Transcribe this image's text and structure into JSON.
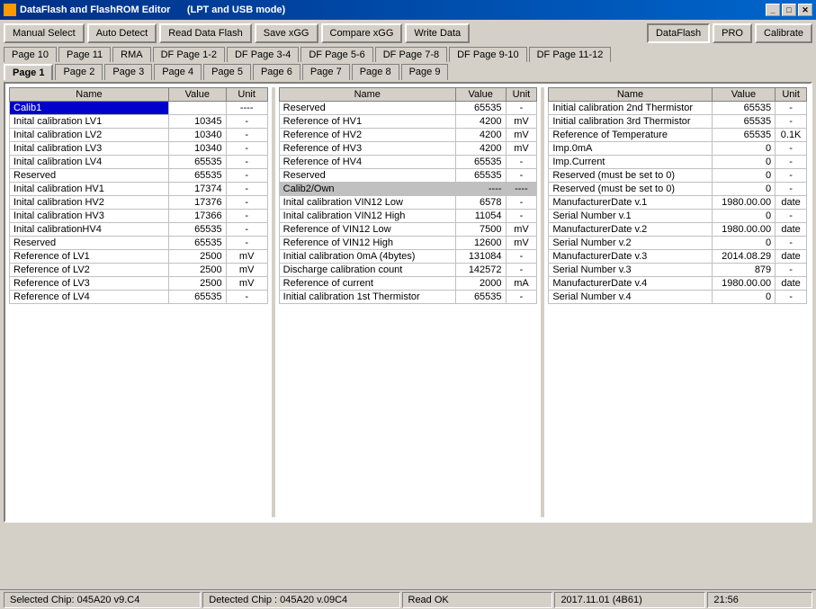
{
  "titleBar": {
    "title": "DataFlash  and  FlashROM  Editor",
    "subtitle": "(LPT and USB mode)",
    "minimizeBtn": "_",
    "maximizeBtn": "□",
    "closeBtn": "✕"
  },
  "toolbar": {
    "buttons": [
      {
        "id": "manual-select",
        "label": "Manual Select"
      },
      {
        "id": "auto-detect",
        "label": "Auto Detect"
      },
      {
        "id": "read-data-flash",
        "label": "Read Data Flash"
      },
      {
        "id": "save-xgg",
        "label": "Save xGG"
      },
      {
        "id": "compare-xgg",
        "label": "Compare xGG"
      },
      {
        "id": "write-data",
        "label": "Write Data"
      },
      {
        "id": "dataflash",
        "label": "DataFlash",
        "active": true
      },
      {
        "id": "pro",
        "label": "PRO"
      },
      {
        "id": "calibrate",
        "label": "Calibrate"
      }
    ]
  },
  "topTabs": [
    {
      "id": "page10",
      "label": "Page 10"
    },
    {
      "id": "page11",
      "label": "Page 11"
    },
    {
      "id": "rma",
      "label": "RMA"
    },
    {
      "id": "df-page-1-2",
      "label": "DF Page 1-2"
    },
    {
      "id": "df-page-3-4",
      "label": "DF Page 3-4"
    },
    {
      "id": "df-page-5-6",
      "label": "DF Page 5-6"
    },
    {
      "id": "df-page-7-8",
      "label": "DF Page 7-8"
    },
    {
      "id": "df-page-9-10",
      "label": "DF Page 9-10"
    },
    {
      "id": "df-page-11-12",
      "label": "DF Page 11-12"
    }
  ],
  "bottomTabs": [
    {
      "id": "page1",
      "label": "Page 1",
      "active": true
    },
    {
      "id": "page2",
      "label": "Page 2"
    },
    {
      "id": "page3",
      "label": "Page 3"
    },
    {
      "id": "page4",
      "label": "Page 4"
    },
    {
      "id": "page5",
      "label": "Page 5"
    },
    {
      "id": "page6",
      "label": "Page 6"
    },
    {
      "id": "page7",
      "label": "Page 7"
    },
    {
      "id": "page8",
      "label": "Page 8"
    },
    {
      "id": "page9",
      "label": "Page 9"
    }
  ],
  "table1": {
    "headers": [
      "Name",
      "Value",
      "Unit"
    ],
    "rows": [
      {
        "name": "Calib1",
        "value": "",
        "unit": "----",
        "highlight": "blue"
      },
      {
        "name": "Inital calibration LV1",
        "value": "10345",
        "unit": "-"
      },
      {
        "name": "Inital calibration LV2",
        "value": "10340",
        "unit": "-"
      },
      {
        "name": "Inital calibration LV3",
        "value": "10340",
        "unit": "-"
      },
      {
        "name": "Inital calibration LV4",
        "value": "65535",
        "unit": "-"
      },
      {
        "name": "Reserved",
        "value": "65535",
        "unit": "-"
      },
      {
        "name": "Inital calibration HV1",
        "value": "17374",
        "unit": "-"
      },
      {
        "name": "Inital calibration HV2",
        "value": "17376",
        "unit": "-"
      },
      {
        "name": "Inital calibration HV3",
        "value": "17366",
        "unit": "-"
      },
      {
        "name": "Inital calibrationHV4",
        "value": "65535",
        "unit": "-"
      },
      {
        "name": "Reserved",
        "value": "65535",
        "unit": "-"
      },
      {
        "name": "Reference of LV1",
        "value": "2500",
        "unit": "mV"
      },
      {
        "name": "Reference of LV2",
        "value": "2500",
        "unit": "mV"
      },
      {
        "name": "Reference of LV3",
        "value": "2500",
        "unit": "mV"
      },
      {
        "name": "Reference of LV4",
        "value": "65535",
        "unit": "-"
      }
    ]
  },
  "table2": {
    "headers": [
      "Name",
      "Value",
      "Unit"
    ],
    "rows": [
      {
        "name": "Reserved",
        "value": "65535",
        "unit": "-"
      },
      {
        "name": "Reference of HV1",
        "value": "4200",
        "unit": "mV"
      },
      {
        "name": "Reference of HV2",
        "value": "4200",
        "unit": "mV"
      },
      {
        "name": "Reference of HV3",
        "value": "4200",
        "unit": "mV"
      },
      {
        "name": "Reference of HV4",
        "value": "65535",
        "unit": "-"
      },
      {
        "name": "Reserved",
        "value": "65535",
        "unit": "-"
      },
      {
        "name": "Calib2/Own",
        "value": "----",
        "unit": "----",
        "highlight": "gray"
      },
      {
        "name": "Inital calibration VIN12 Low",
        "value": "6578",
        "unit": "-"
      },
      {
        "name": "Inital calibration VIN12 High",
        "value": "11054",
        "unit": "-"
      },
      {
        "name": "Reference of VIN12 Low",
        "value": "7500",
        "unit": "mV"
      },
      {
        "name": "Reference of VIN12 High",
        "value": "12600",
        "unit": "mV"
      },
      {
        "name": "Initial calibration 0mA (4bytes)",
        "value": "131084",
        "unit": "-"
      },
      {
        "name": "Discharge calibration count",
        "value": "142572",
        "unit": "-"
      },
      {
        "name": "Reference of current",
        "value": "2000",
        "unit": "mA"
      },
      {
        "name": "Initial calibration 1st Thermistor",
        "value": "65535",
        "unit": "-"
      }
    ]
  },
  "table3": {
    "headers": [
      "Name",
      "Value",
      "Unit"
    ],
    "rows": [
      {
        "name": "Initial calibration 2nd Thermistor",
        "value": "65535",
        "unit": "-"
      },
      {
        "name": "Initial calibration 3rd Thermistor",
        "value": "65535",
        "unit": "-"
      },
      {
        "name": "Reference of Temperature",
        "value": "65535",
        "unit": "0.1K"
      },
      {
        "name": "Imp.0mA",
        "value": "0",
        "unit": "-"
      },
      {
        "name": "Imp.Current",
        "value": "0",
        "unit": "-"
      },
      {
        "name": "Reserved (must be set to 0)",
        "value": "0",
        "unit": "-"
      },
      {
        "name": "Reserved (must be set to 0)",
        "value": "0",
        "unit": "-"
      },
      {
        "name": "ManufacturerDate v.1",
        "value": "1980.00.00",
        "unit": "date"
      },
      {
        "name": "Serial Number v.1",
        "value": "0",
        "unit": "-"
      },
      {
        "name": "ManufacturerDate v.2",
        "value": "1980.00.00",
        "unit": "date"
      },
      {
        "name": "Serial Number v.2",
        "value": "0",
        "unit": "-"
      },
      {
        "name": "ManufacturerDate v.3",
        "value": "2014.08.29",
        "unit": "date"
      },
      {
        "name": "Serial Number v.3",
        "value": "879",
        "unit": "-"
      },
      {
        "name": "ManufacturerDate v.4",
        "value": "1980.00.00",
        "unit": "date"
      },
      {
        "name": "Serial Number v.4",
        "value": "0",
        "unit": "-"
      }
    ]
  },
  "statusBar": {
    "chip": "Selected Chip: 045A20 v9.C4",
    "detected": "Detected Chip : 045A20  v.09C4",
    "status": "Read OK",
    "date": "2017.11.01 (4B61)",
    "time": "21:56"
  }
}
